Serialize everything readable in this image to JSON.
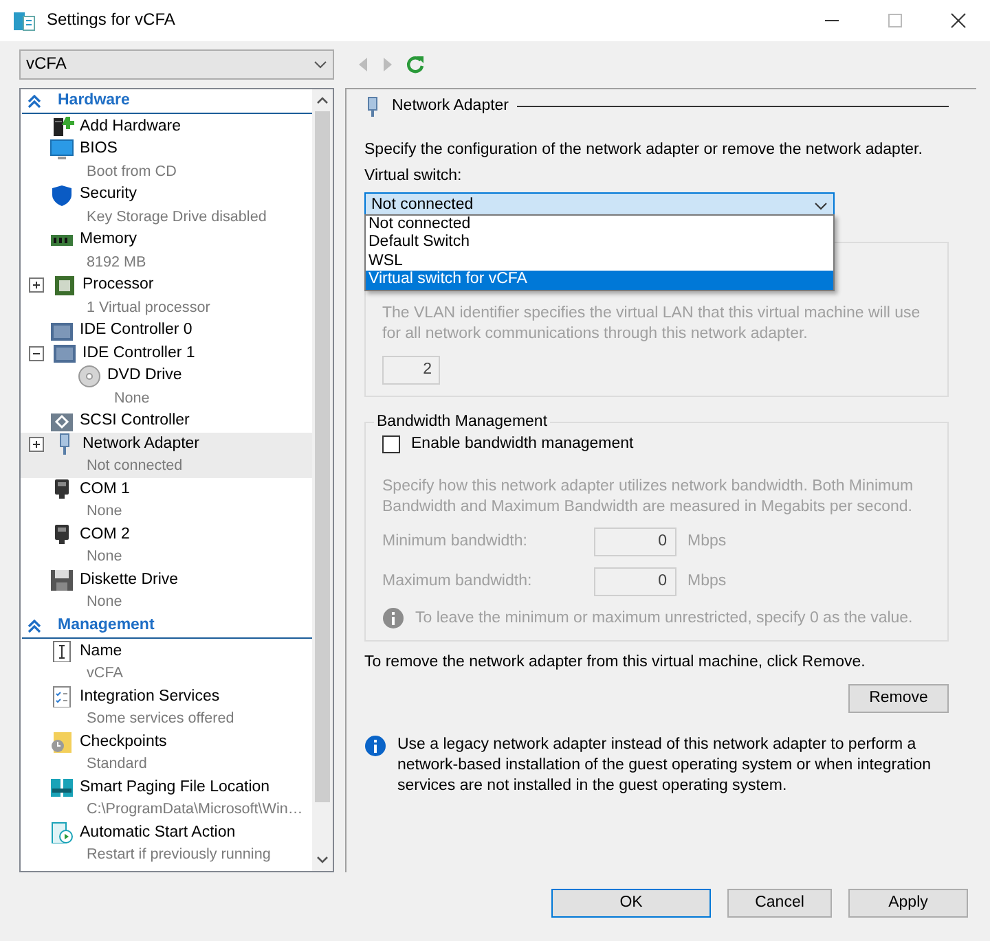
{
  "window": {
    "title": "Settings for vCFA"
  },
  "vm_selector": {
    "value": "vCFA"
  },
  "sidebar": {
    "sections": [
      {
        "title": "Hardware",
        "expanded": true,
        "items": [
          {
            "kind": "add-hardware",
            "label": "Add Hardware",
            "selected": false
          },
          {
            "kind": "bios",
            "label": "BIOS",
            "detail": "Boot from CD",
            "selected": false
          },
          {
            "kind": "security",
            "label": "Security",
            "detail": "Key Storage Drive disabled",
            "selected": false
          },
          {
            "kind": "memory",
            "label": "Memory",
            "detail": "8192 MB",
            "selected": false
          },
          {
            "kind": "processor",
            "label": "Processor",
            "detail": "1 Virtual processor",
            "expanded": false,
            "selected": false
          },
          {
            "kind": "ide",
            "label": "IDE Controller 0",
            "selected": false
          },
          {
            "kind": "ide",
            "label": "IDE Controller 1",
            "expanded": true,
            "selected": false,
            "children": [
              {
                "kind": "dvd",
                "label": "DVD Drive",
                "detail": "None",
                "selected": false
              }
            ]
          },
          {
            "kind": "scsi",
            "label": "SCSI Controller",
            "selected": false
          },
          {
            "kind": "network",
            "label": "Network Adapter",
            "detail": "Not connected",
            "expanded": false,
            "selected": true
          },
          {
            "kind": "com",
            "label": "COM 1",
            "detail": "None",
            "selected": false
          },
          {
            "kind": "com",
            "label": "COM 2",
            "detail": "None",
            "selected": false
          },
          {
            "kind": "diskette",
            "label": "Diskette Drive",
            "detail": "None",
            "selected": false
          }
        ]
      },
      {
        "title": "Management",
        "expanded": true,
        "items": [
          {
            "kind": "name",
            "label": "Name",
            "detail": "vCFA",
            "selected": false
          },
          {
            "kind": "integration",
            "label": "Integration Services",
            "detail": "Some services offered",
            "selected": false
          },
          {
            "kind": "checkpoints",
            "label": "Checkpoints",
            "detail": "Standard",
            "selected": false
          },
          {
            "kind": "paging",
            "label": "Smart Paging File Location",
            "detail": "C:\\ProgramData\\Microsoft\\Win…",
            "selected": false
          },
          {
            "kind": "autostart",
            "label": "Automatic Start Action",
            "detail": "Restart if previously running",
            "selected": false
          }
        ]
      }
    ]
  },
  "panel": {
    "title": "Network Adapter",
    "description": "Specify the configuration of the network adapter or remove the network adapter.",
    "switch_label": "Virtual switch:",
    "switch": {
      "value": "Not connected",
      "open": true,
      "options": [
        {
          "label": "Not connected",
          "highlighted": false
        },
        {
          "label": "Default Switch",
          "highlighted": false
        },
        {
          "label": "WSL",
          "highlighted": false
        },
        {
          "label": "Virtual switch for vCFA",
          "highlighted": true
        }
      ]
    },
    "vlan": {
      "description": "The VLAN identifier specifies the virtual LAN that this virtual machine will use for all network communications through this network adapter.",
      "value": "2",
      "disabled": true
    },
    "bandwidth": {
      "title": "Bandwidth Management",
      "checkbox": {
        "label": "Enable bandwidth management",
        "checked": false
      },
      "description": "Specify how this network adapter utilizes network bandwidth. Both Minimum Bandwidth and Maximum Bandwidth are measured in Megabits per second.",
      "disabled": true,
      "fields": [
        {
          "label": "Minimum bandwidth:",
          "value": "0",
          "unit": "Mbps"
        },
        {
          "label": "Maximum bandwidth:",
          "value": "0",
          "unit": "Mbps"
        }
      ],
      "note": "To leave the minimum or maximum unrestricted, specify 0 as the value."
    },
    "remove_text": "To remove the network adapter from this virtual machine, click Remove.",
    "remove_button": "Remove",
    "info": "Use a legacy network adapter instead of this network adapter to perform a network-based installation of the guest operating system or when integration services are not installed in the guest operating system."
  },
  "buttons": [
    {
      "label": "OK",
      "default": true
    },
    {
      "label": "Cancel",
      "default": false
    },
    {
      "label": "Apply",
      "default": false
    }
  ]
}
